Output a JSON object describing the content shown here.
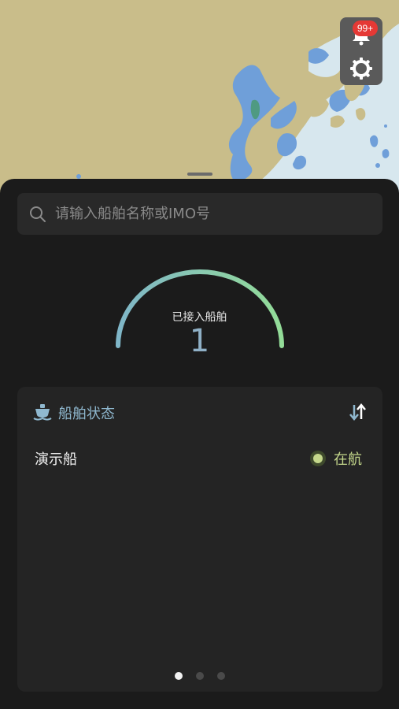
{
  "map": {
    "land_color": "#c9bd8a",
    "water_color": "#d7e7ee",
    "deep_water_color": "#6f9fd9"
  },
  "notifications": {
    "badge": "99+",
    "icon": "bell-icon"
  },
  "settings": {
    "icon": "gear-icon"
  },
  "search": {
    "placeholder": "请输入船舶名称或IMO号",
    "value": "",
    "icon": "search-icon"
  },
  "gauge": {
    "label": "已接入船舶",
    "value": "1",
    "fraction": 1.0,
    "color_start": "#7fb6c8",
    "color_end": "#93dc98"
  },
  "ship_status": {
    "title": "船舶状态",
    "title_icon": "ship-icon",
    "sort_icon": "sort-icon",
    "ships": [
      {
        "name": "演示船",
        "status": "在航",
        "status_color": "#c4d78b"
      }
    ]
  },
  "pager": {
    "pages": 3,
    "active": 0
  }
}
